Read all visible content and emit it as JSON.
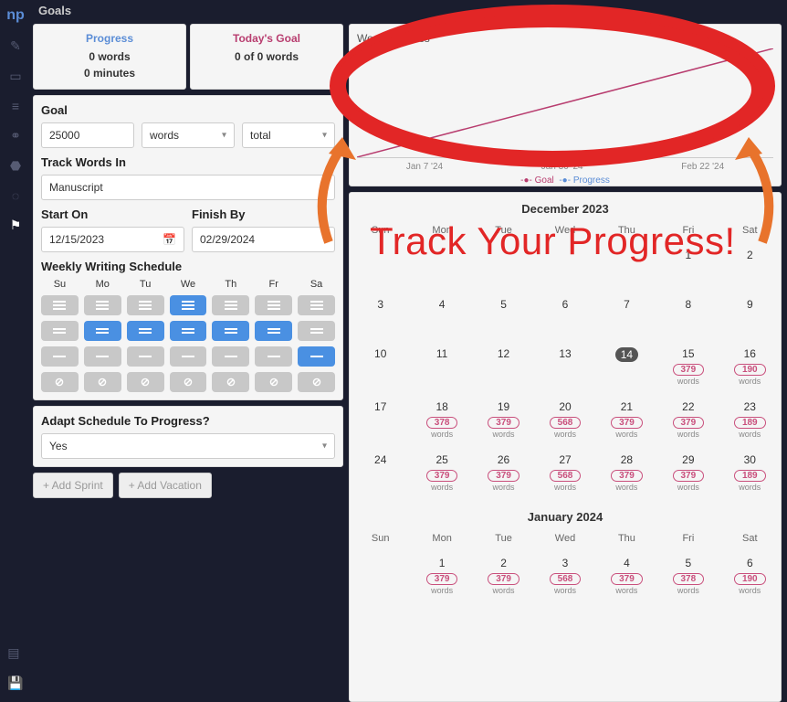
{
  "header": {
    "title": "Goals"
  },
  "sidebarLogo": "np",
  "stats": {
    "progress": {
      "title": "Progress",
      "line1": "0 words",
      "line2": "0 minutes"
    },
    "today": {
      "title": "Today's Goal",
      "line1": "0 of 0 words"
    }
  },
  "goal": {
    "label": "Goal",
    "amount": "25000",
    "unit": "words",
    "scope": "total",
    "trackLabel": "Track Words In",
    "trackIn": "Manuscript",
    "startLabel": "Start On",
    "startDate": "12/15/2023",
    "finishLabel": "Finish By",
    "finishDate": "02/29/2024",
    "scheduleLabel": "Weekly Writing Schedule",
    "days": [
      "Su",
      "Mo",
      "Tu",
      "We",
      "Th",
      "Fr",
      "Sa"
    ],
    "schedule": [
      [
        "gray",
        "gray",
        "gray",
        "blue",
        "gray",
        "gray",
        "gray"
      ],
      [
        "gray",
        "blue",
        "blue",
        "blue",
        "blue",
        "blue",
        "gray"
      ],
      [
        "gray",
        "gray",
        "gray",
        "gray",
        "gray",
        "gray",
        "blue"
      ],
      [
        "gray",
        "gray",
        "gray",
        "gray",
        "gray",
        "gray",
        "gray"
      ]
    ],
    "adaptLabel": "Adapt Schedule To Progress?",
    "adapt": "Yes",
    "addSprint": "+ Add Sprint",
    "addVacation": "+ Add Vacation"
  },
  "chart": {
    "title": "Word Progress",
    "ticks": [
      "Jan 7 '24",
      "Jan 30 '24",
      "Feb 22 '24"
    ],
    "legend": {
      "goal": "Goal",
      "progress": "Progress"
    }
  },
  "chart_data": {
    "type": "line",
    "title": "Word Progress",
    "xlabel": "",
    "ylabel": "",
    "series": [
      {
        "name": "Goal",
        "color": "#b83d6f",
        "x_dates": [
          "2023-12-15",
          "2024-02-29"
        ],
        "values": [
          0,
          25000
        ]
      },
      {
        "name": "Progress",
        "color": "#5b8dd6",
        "x_dates": [],
        "values": []
      }
    ],
    "x_ticks": [
      "Jan 7 '24",
      "Jan 30 '24",
      "Feb 22 '24"
    ],
    "ylim": [
      0,
      25000
    ]
  },
  "calendars": [
    {
      "title": "December 2023",
      "days": [
        "Sun",
        "Mon",
        "Tue",
        "Wed",
        "Thu",
        "Fri",
        "Sat"
      ],
      "rows": [
        [
          {
            "d": ""
          },
          {
            "d": ""
          },
          {
            "d": ""
          },
          {
            "d": ""
          },
          {
            "d": ""
          },
          {
            "d": "1"
          },
          {
            "d": "2"
          }
        ],
        [
          {
            "d": "3"
          },
          {
            "d": "4"
          },
          {
            "d": "5"
          },
          {
            "d": "6"
          },
          {
            "d": "7"
          },
          {
            "d": "8"
          },
          {
            "d": "9"
          }
        ],
        [
          {
            "d": "10"
          },
          {
            "d": "11"
          },
          {
            "d": "12"
          },
          {
            "d": "13"
          },
          {
            "d": "14",
            "today": true
          },
          {
            "d": "15",
            "w": "379"
          },
          {
            "d": "16",
            "w": "190"
          }
        ],
        [
          {
            "d": "17"
          },
          {
            "d": "18",
            "w": "378"
          },
          {
            "d": "19",
            "w": "379"
          },
          {
            "d": "20",
            "w": "568"
          },
          {
            "d": "21",
            "w": "379"
          },
          {
            "d": "22",
            "w": "379"
          },
          {
            "d": "23",
            "w": "189"
          }
        ],
        [
          {
            "d": "24"
          },
          {
            "d": "25",
            "w": "379"
          },
          {
            "d": "26",
            "w": "379"
          },
          {
            "d": "27",
            "w": "568"
          },
          {
            "d": "28",
            "w": "379"
          },
          {
            "d": "29",
            "w": "379"
          },
          {
            "d": "30",
            "w": "189"
          }
        ]
      ]
    },
    {
      "title": "January 2024",
      "days": [
        "Sun",
        "Mon",
        "Tue",
        "Wed",
        "Thu",
        "Fri",
        "Sat"
      ],
      "rows": [
        [
          {
            "d": ""
          },
          {
            "d": "1",
            "w": "379"
          },
          {
            "d": "2",
            "w": "379"
          },
          {
            "d": "3",
            "w": "568"
          },
          {
            "d": "4",
            "w": "379"
          },
          {
            "d": "5",
            "w": "378"
          },
          {
            "d": "6",
            "w": "190"
          }
        ]
      ]
    }
  ],
  "wordsLabel": "words",
  "annotation": {
    "text": "Track Your Progress!"
  },
  "colors": {
    "accent": "#b83d6f",
    "blue": "#4a90e2",
    "red": "#e22626",
    "orange": "#e8732c"
  }
}
